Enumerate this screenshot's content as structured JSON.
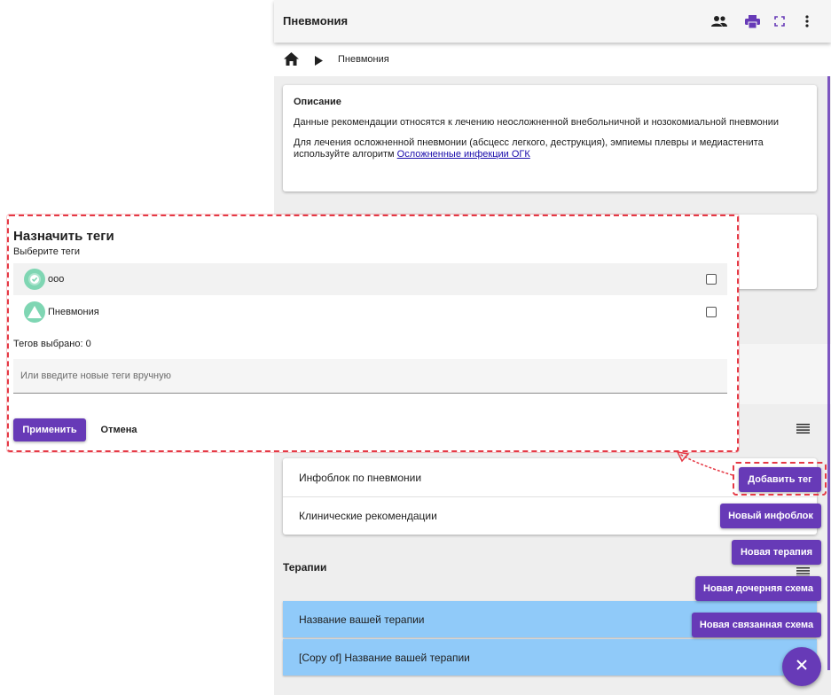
{
  "topbar": {
    "title": "Пневмония"
  },
  "breadcrumb": {
    "current": "Пневмония"
  },
  "description": {
    "title": "Описание",
    "line1": "Данные рекомендации относятся к лечению неосложненной внебольничной и нозокомиальной пневмонии",
    "line2_text": "Для лечения осложненной пневмонии (абсцесс легкого, деструкция), эмпиемы плевры и медиастенита используйте алгоритм",
    "line2_link": "Осложненные инфекции ОГК"
  },
  "infoblocks": [
    {
      "label": "Инфоблок по пневмонии"
    },
    {
      "label": "Клинические рекомендации"
    }
  ],
  "therapies": {
    "title": "Терапии",
    "items": [
      {
        "label": "Название вашей терапии"
      },
      {
        "label": "[Copy of] Название вашей терапии"
      }
    ]
  },
  "speed_dial": {
    "add_tag": "Добавить тег",
    "new_infoblock": "Новый инфоблок",
    "new_therapy": "Новая терапия",
    "new_child_scheme": "Новая дочерняя схема",
    "new_linked_scheme": "Новая связанная схема"
  },
  "dialog": {
    "title": "Назначить теги",
    "subtitle": "Выберите теги",
    "tags": [
      {
        "label": "ооо",
        "icon": "verified-badge-icon"
      },
      {
        "label": "Пневмония",
        "icon": "warning-triangle-icon"
      }
    ],
    "selected_count_text": "Тегов выбрано: 0",
    "manual_input_placeholder": "Или введите новые теги вручную",
    "apply_label": "Применить",
    "cancel_label": "Отмена"
  },
  "colors": {
    "accent": "#673ab7",
    "therapy_row": "#90caf9",
    "highlight": "#e53945",
    "tag_avatar": "#7fd6b3"
  }
}
